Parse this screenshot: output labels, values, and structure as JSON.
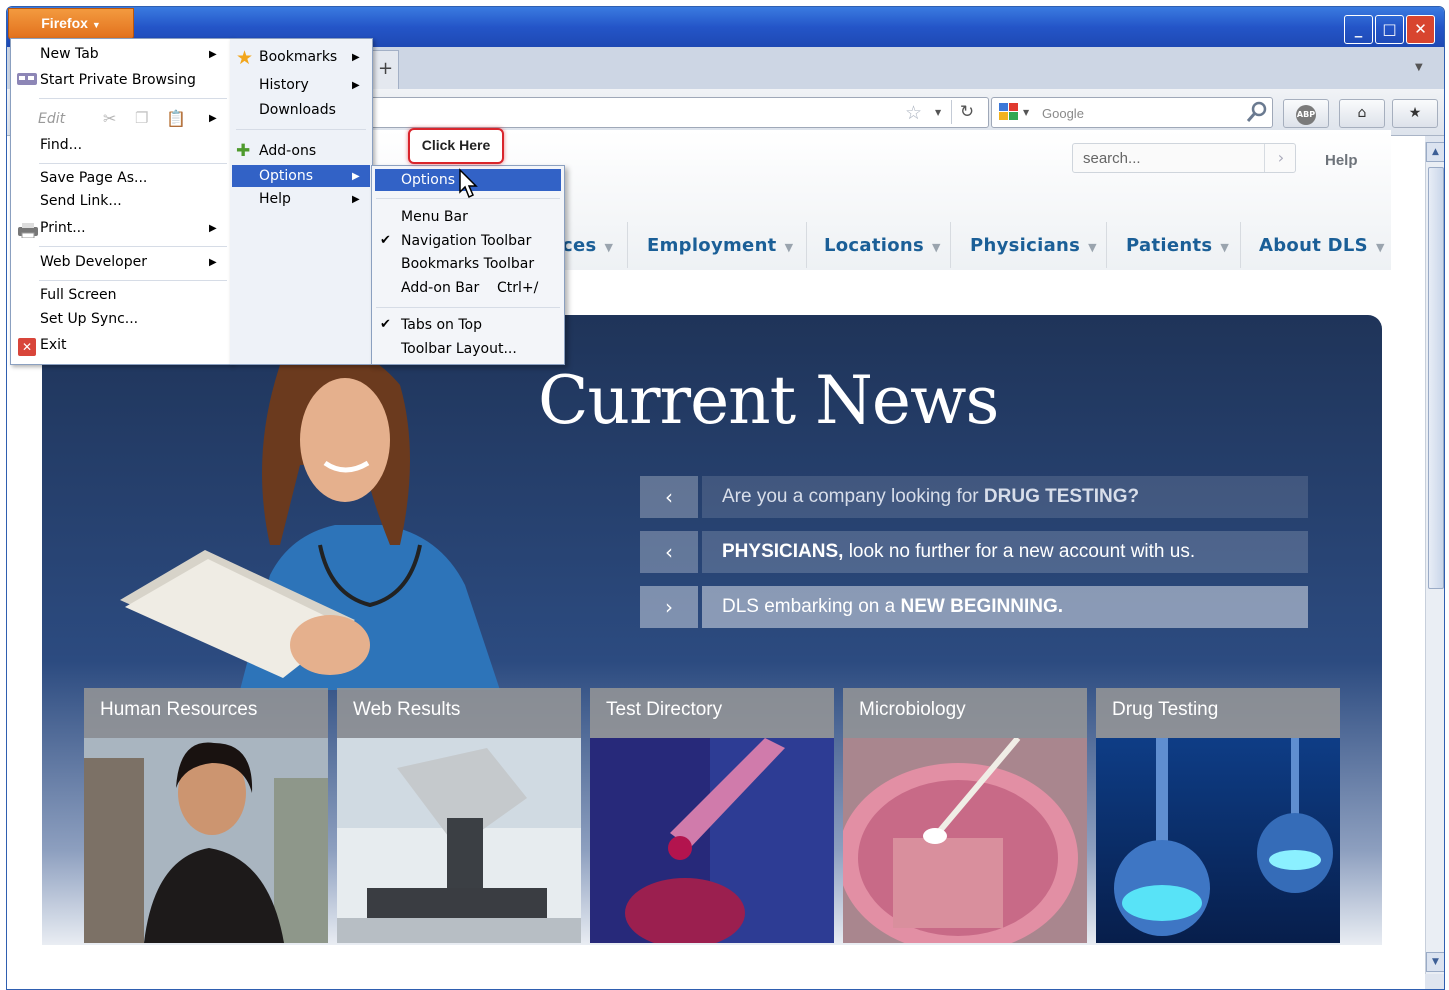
{
  "window": {
    "app_button": "Firefox",
    "search_placeholder": "Google",
    "controls": {
      "minimize": "_",
      "maximize": "□",
      "close": "✕"
    }
  },
  "firefox_menu": {
    "main": [
      {
        "label": "New Tab",
        "submenu": true
      },
      {
        "label": "Start Private Browsing",
        "submenu": false
      },
      {
        "label": "Edit",
        "submenu": true,
        "disabled": true
      },
      {
        "label": "Find...",
        "submenu": false
      },
      {
        "label": "Save Page As...",
        "submenu": false
      },
      {
        "label": "Send Link...",
        "submenu": false
      },
      {
        "label": "Print...",
        "submenu": true
      },
      {
        "label": "Web Developer",
        "submenu": true
      },
      {
        "label": "Full Screen",
        "submenu": false
      },
      {
        "label": "Set Up Sync...",
        "submenu": false
      },
      {
        "label": "Exit",
        "submenu": false
      }
    ],
    "side": [
      {
        "label": "Bookmarks",
        "submenu": true
      },
      {
        "label": "History",
        "submenu": true
      },
      {
        "label": "Downloads",
        "submenu": false
      },
      {
        "label": "Add-ons",
        "submenu": false
      },
      {
        "label": "Options",
        "submenu": true,
        "highlighted": true
      },
      {
        "label": "Help",
        "submenu": true
      }
    ],
    "options_submenu": [
      {
        "label": "Options",
        "highlighted": true
      },
      {
        "label": "Menu Bar",
        "checked": false
      },
      {
        "label": "Navigation Toolbar",
        "checked": true
      },
      {
        "label": "Bookmarks Toolbar",
        "checked": false
      },
      {
        "label": "Add-on Bar",
        "shortcut": "Ctrl+/",
        "checked": false
      },
      {
        "label": "Tabs on Top",
        "checked": true
      },
      {
        "label": "Toolbar Layout...",
        "checked": false
      }
    ]
  },
  "callout": {
    "label": "Click Here"
  },
  "site": {
    "search_placeholder": "search...",
    "help": "Help",
    "nav": [
      {
        "label": "ces"
      },
      {
        "label": "Employment"
      },
      {
        "label": "Locations"
      },
      {
        "label": "Physicians"
      },
      {
        "label": "Patients"
      },
      {
        "label": "About DLS"
      }
    ],
    "banner_title": "Current News",
    "news": [
      {
        "arrow": "‹",
        "lead": "Are you a company looking for ",
        "bold": "DRUG TESTING?",
        "tail": ""
      },
      {
        "arrow": "‹",
        "lead": "",
        "bold": "PHYSICIANS,",
        "tail": " look no further for a new account with us."
      },
      {
        "arrow": "›",
        "lead": "DLS embarking on a ",
        "bold": "NEW BEGINNING.",
        "tail": ""
      }
    ],
    "tiles": [
      {
        "label": "Human Resources"
      },
      {
        "label": "Web Results"
      },
      {
        "label": "Test Directory"
      },
      {
        "label": "Microbiology"
      },
      {
        "label": "Drug Testing"
      }
    ]
  },
  "colors": {
    "accent": "#3262c6",
    "nav_text": "#1b5f97",
    "callout_border": "#d9252c",
    "firefox_button": "#e2701c"
  }
}
